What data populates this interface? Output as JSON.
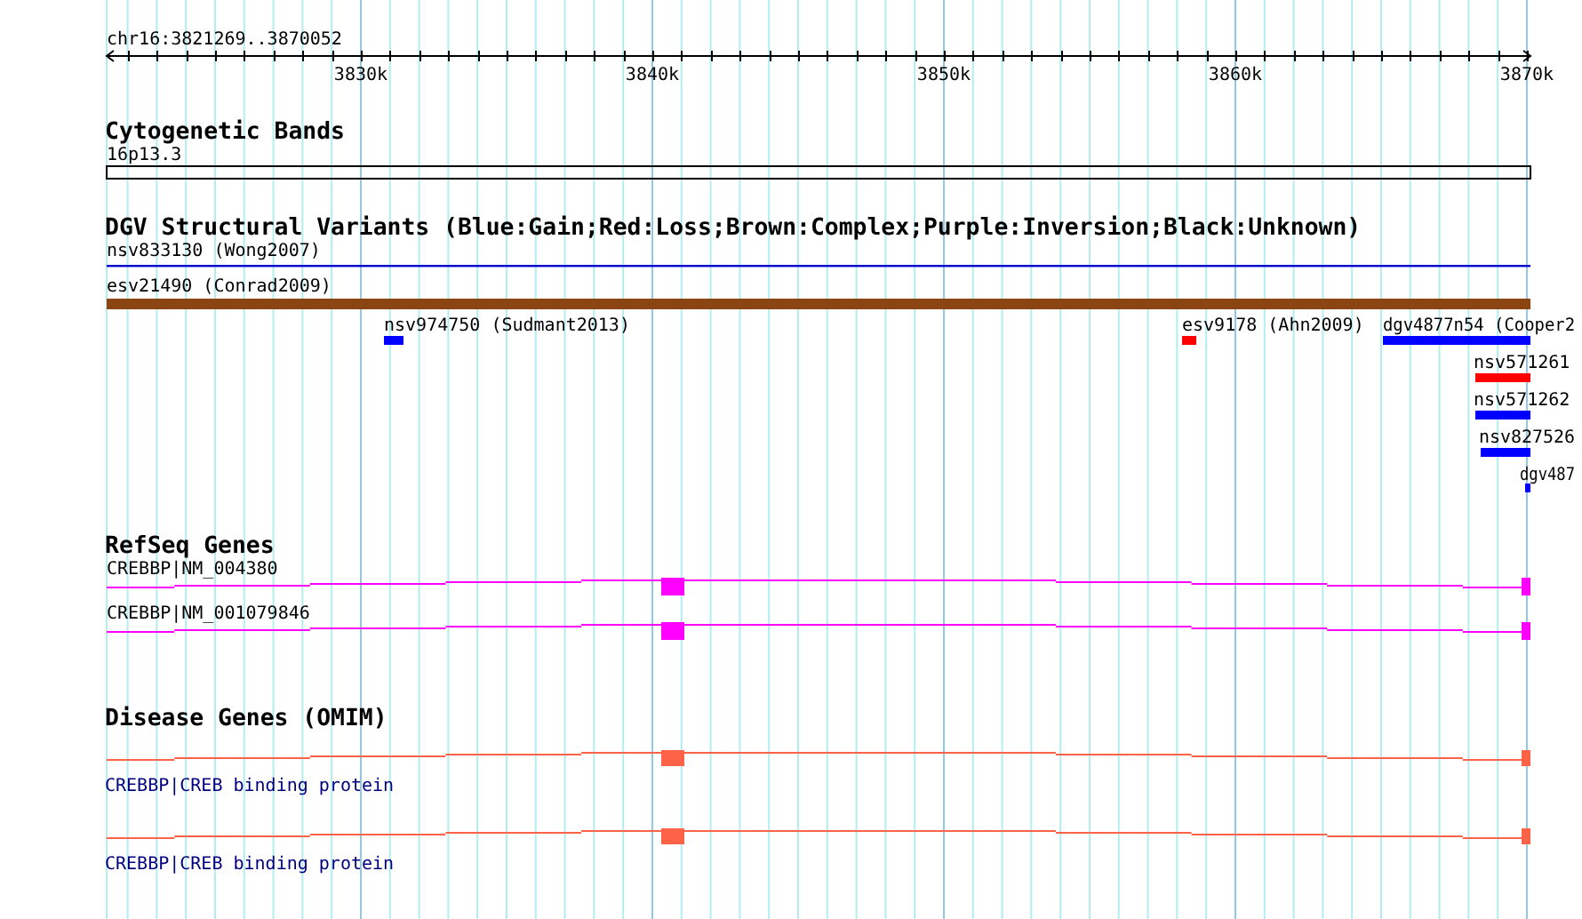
{
  "location": "chr16:3821269..3870052",
  "ruler": {
    "tick_labels": [
      "3830k",
      "3840k",
      "3850k",
      "3860k",
      "3870k"
    ]
  },
  "tracks": [
    {
      "title": "Cytogenetic Bands",
      "kind": "bands",
      "features": [
        {
          "label": "16p13.3"
        }
      ]
    },
    {
      "title": "DGV Structural Variants (Blue:Gain;Red:Loss;Brown:Complex;Purple:Inversion;Black:Unknown)",
      "kind": "variants",
      "features": [
        {
          "label": "nsv833130 (Wong2007)",
          "color": "#0000cc"
        },
        {
          "label": "esv21490 (Conrad2009)",
          "color": "#8b4513"
        },
        {
          "label": "nsv974750 (Sudmant2013)",
          "color": "#0000ff"
        },
        {
          "label": "esv9178 (Ahn2009)",
          "color": "#ff0000"
        },
        {
          "label": "dgv4877n54 (Cooper2",
          "color": "#0000ff"
        },
        {
          "label": "nsv571261",
          "color": "#ff0000"
        },
        {
          "label": "nsv571262",
          "color": "#0000ff"
        },
        {
          "label": "nsv827526",
          "color": "#0000ff"
        },
        {
          "label": "dgv487",
          "color": "#0000ff"
        }
      ]
    },
    {
      "title": "RefSeq Genes",
      "kind": "genes",
      "features": [
        {
          "label": "CREBBP|NM_004380"
        },
        {
          "label": "CREBBP|NM_001079846"
        }
      ]
    },
    {
      "title": "Disease Genes (OMIM)",
      "kind": "disease",
      "features": [
        {
          "label": "CREBBP|CREB binding protein"
        },
        {
          "label": "CREBBP|CREB binding protein"
        }
      ]
    }
  ]
}
